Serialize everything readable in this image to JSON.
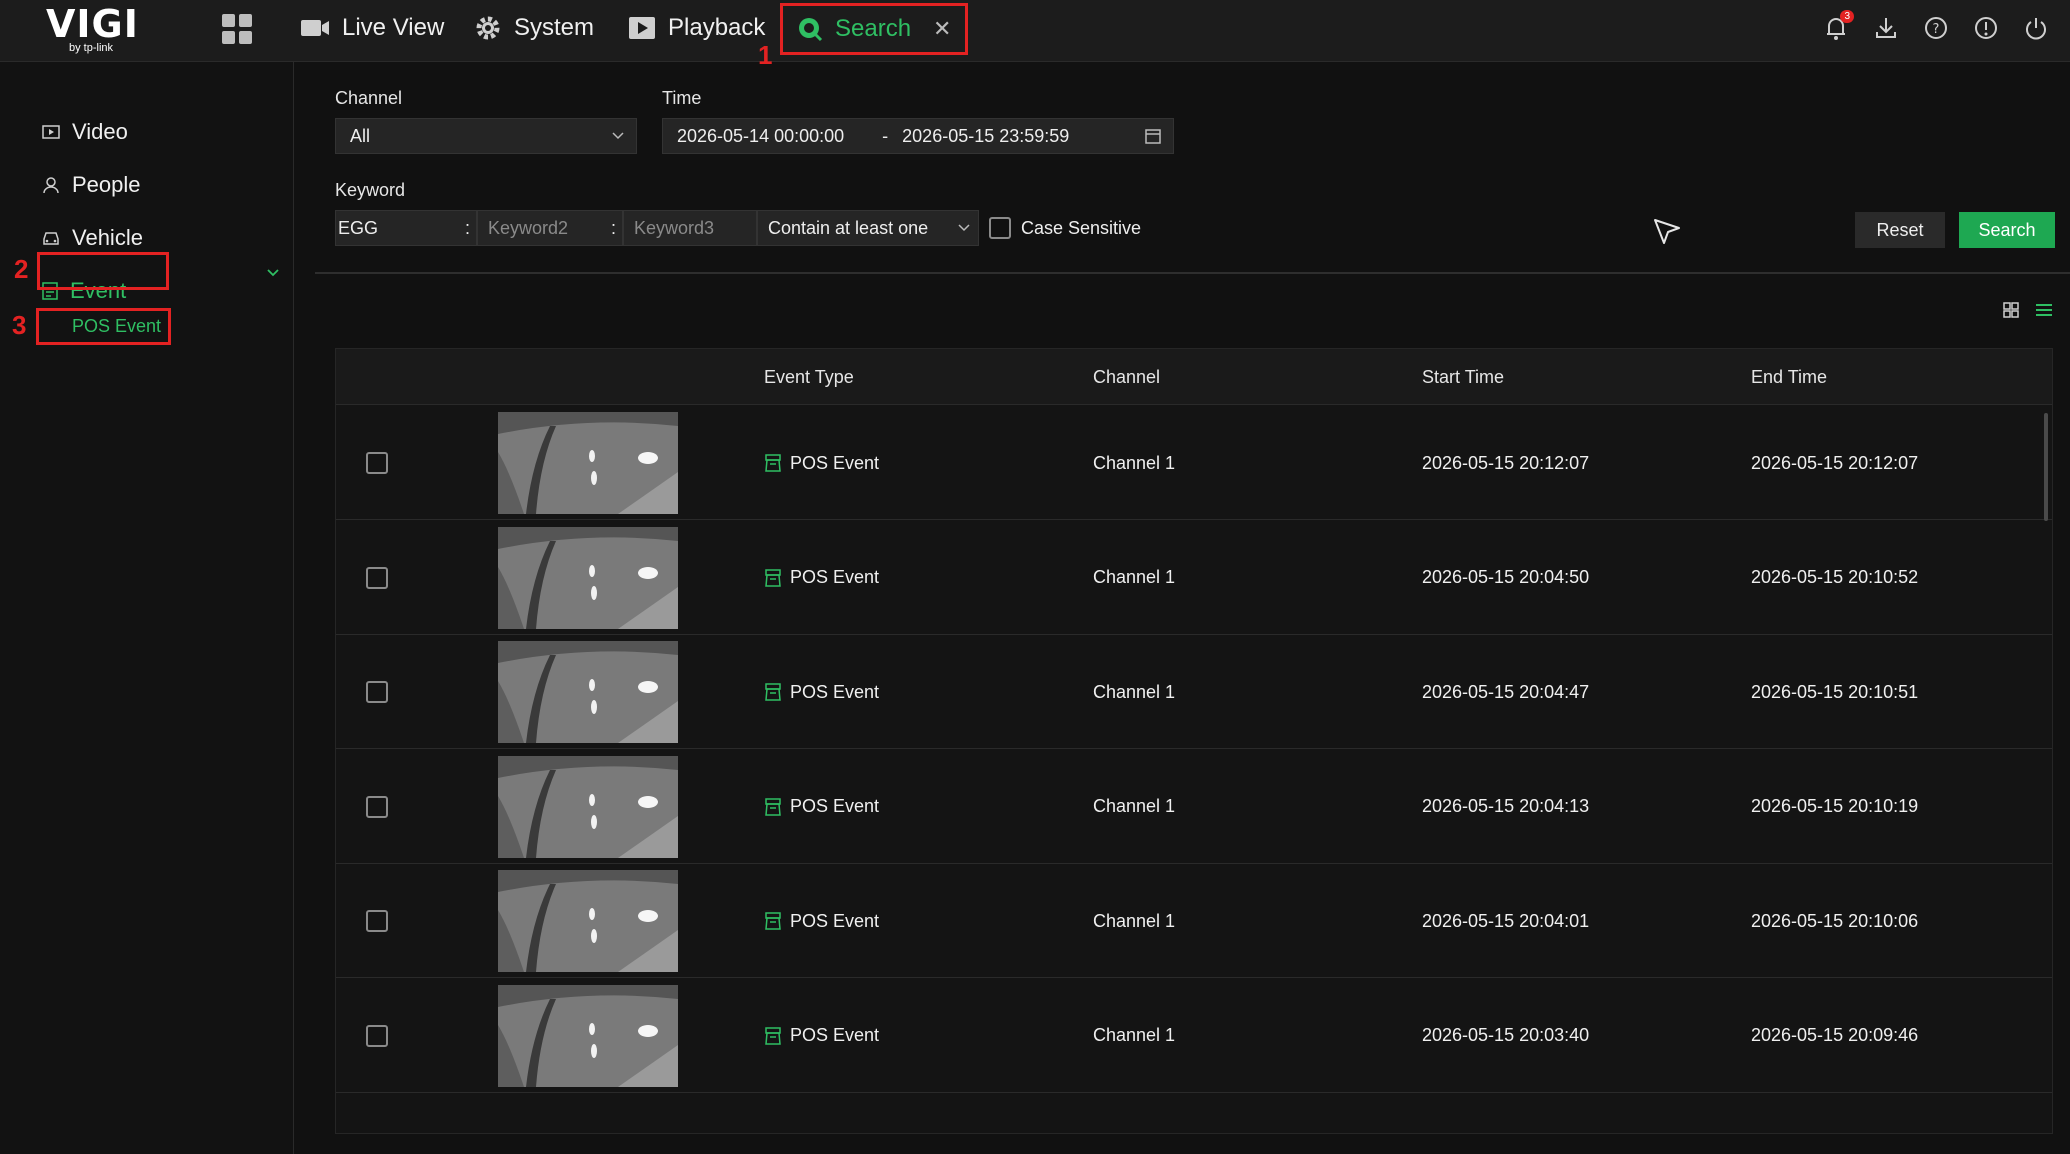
{
  "topbar": {
    "logo": "VIGI",
    "logo_sub": "by tp-link",
    "tabs": [
      {
        "label": "Live View",
        "icon": "camera-icon"
      },
      {
        "label": "System",
        "icon": "gear-icon"
      },
      {
        "label": "Playback",
        "icon": "play-icon"
      },
      {
        "label": "Search",
        "icon": "search-icon"
      }
    ],
    "notification_count": "3",
    "annotation_1": "1"
  },
  "sidebar": {
    "items": [
      {
        "label": "Video",
        "icon": "video-icon"
      },
      {
        "label": "People",
        "icon": "person-icon"
      },
      {
        "label": "Vehicle",
        "icon": "car-icon"
      },
      {
        "label": "Event",
        "icon": "document-icon"
      }
    ],
    "sub_item": "POS Event",
    "annotation_2": "2",
    "annotation_3": "3"
  },
  "filters": {
    "channel_label": "Channel",
    "channel_value": "All",
    "time_label": "Time",
    "time_start": "2026-05-14 00:00:00",
    "time_sep": "-",
    "time_end": "2026-05-15 23:59:59",
    "keyword_label": "Keyword",
    "keyword1": "EGG",
    "keyword2_placeholder": "Keyword2",
    "keyword3_placeholder": "Keyword3",
    "separator": ":",
    "match_mode": "Contain at least one",
    "case_sensitive": "Case Sensitive",
    "reset_label": "Reset",
    "search_label": "Search"
  },
  "table": {
    "columns": [
      "Event Type",
      "Channel",
      "Start Time",
      "End Time"
    ],
    "rows": [
      {
        "type": "POS Event",
        "channel": "Channel 1",
        "start": "2026-05-15 20:12:07",
        "end": "2026-05-15 20:12:07"
      },
      {
        "type": "POS Event",
        "channel": "Channel 1",
        "start": "2026-05-15 20:04:50",
        "end": "2026-05-15 20:10:52"
      },
      {
        "type": "POS Event",
        "channel": "Channel 1",
        "start": "2026-05-15 20:04:47",
        "end": "2026-05-15 20:10:51"
      },
      {
        "type": "POS Event",
        "channel": "Channel 1",
        "start": "2026-05-15 20:04:13",
        "end": "2026-05-15 20:10:19"
      },
      {
        "type": "POS Event",
        "channel": "Channel 1",
        "start": "2026-05-15 20:04:01",
        "end": "2026-05-15 20:10:06"
      },
      {
        "type": "POS Event",
        "channel": "Channel 1",
        "start": "2026-05-15 20:03:40",
        "end": "2026-05-15 20:09:46"
      }
    ]
  },
  "colors": {
    "accent": "#2fbf63",
    "annotation": "#e32222",
    "background": "#111111"
  }
}
